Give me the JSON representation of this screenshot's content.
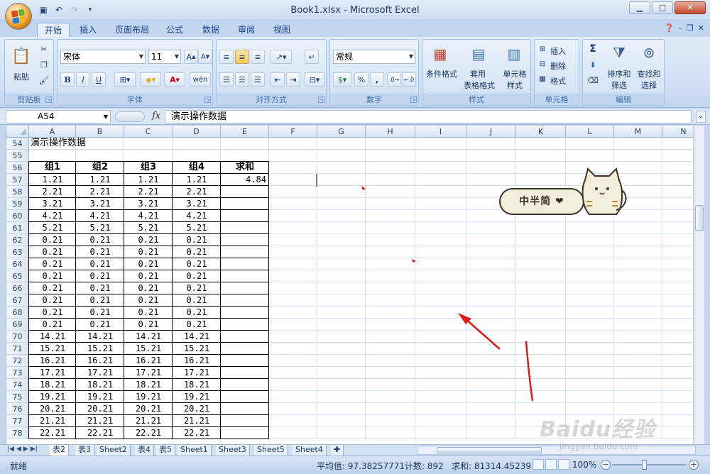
{
  "window": {
    "title": "Book1.xlsx - Microsoft Excel",
    "minimize": "▁",
    "maximize": "□",
    "close": "✕"
  },
  "ribbon_tabs": [
    "开始",
    "插入",
    "页面布局",
    "公式",
    "数据",
    "审阅",
    "视图"
  ],
  "active_tab": "开始",
  "clipboard": {
    "paste": "粘贴",
    "label": "剪贴板"
  },
  "font": {
    "name": "宋体",
    "size": "11",
    "label": "字体",
    "bold": "B",
    "italic": "I",
    "underline": "U",
    "phonetic": "wén"
  },
  "alignment": {
    "label": "对齐方式"
  },
  "number": {
    "format": "常规",
    "label": "数字",
    "percent": "%",
    "comma": ",",
    "inc": "←.0\n.00",
    "dec": ".00\n→.0"
  },
  "styles": {
    "conditional": "条件格式",
    "table1": "套用",
    "table2": "表格格式",
    "cell1": "单元格",
    "cell2": "样式",
    "label": "样式"
  },
  "cells": {
    "insert": "插入",
    "delete": "删除",
    "format": "格式",
    "label": "单元格"
  },
  "editing": {
    "sum": "Σ",
    "sort1": "排序和",
    "sort2": "筛选",
    "find1": "查找和",
    "find2": "选择",
    "label": "编辑"
  },
  "formula_bar": {
    "name_box": "A54",
    "fx": "fx",
    "content": "演示操作数据"
  },
  "grid": {
    "columns": [
      "A",
      "B",
      "C",
      "D",
      "E",
      "F",
      "G",
      "H",
      "I",
      "J",
      "K",
      "L",
      "M",
      "N"
    ],
    "rows": [
      54,
      55,
      56,
      57,
      58,
      59,
      60,
      61,
      62,
      63,
      64,
      65,
      66,
      67,
      68,
      69,
      70,
      71,
      72,
      73,
      74,
      75,
      76,
      77,
      78
    ],
    "title_cell": "演示操作数据",
    "headers": [
      "组1",
      "组2",
      "组3",
      "组4",
      "求和"
    ],
    "data": [
      [
        "1.21",
        "1.21",
        "1.21",
        "1.21",
        "4.84"
      ],
      [
        "2.21",
        "2.21",
        "2.21",
        "2.21",
        ""
      ],
      [
        "3.21",
        "3.21",
        "3.21",
        "3.21",
        ""
      ],
      [
        "4.21",
        "4.21",
        "4.21",
        "4.21",
        ""
      ],
      [
        "5.21",
        "5.21",
        "5.21",
        "5.21",
        ""
      ],
      [
        "0.21",
        "0.21",
        "0.21",
        "0.21",
        ""
      ],
      [
        "0.21",
        "0.21",
        "0.21",
        "0.21",
        ""
      ],
      [
        "0.21",
        "0.21",
        "0.21",
        "0.21",
        ""
      ],
      [
        "0.21",
        "0.21",
        "0.21",
        "0.21",
        ""
      ],
      [
        "0.21",
        "0.21",
        "0.21",
        "0.21",
        ""
      ],
      [
        "0.21",
        "0.21",
        "0.21",
        "0.21",
        ""
      ],
      [
        "0.21",
        "0.21",
        "0.21",
        "0.21",
        ""
      ],
      [
        "0.21",
        "0.21",
        "0.21",
        "0.21",
        ""
      ],
      [
        "14.21",
        "14.21",
        "14.21",
        "14.21",
        ""
      ],
      [
        "15.21",
        "15.21",
        "15.21",
        "15.21",
        ""
      ],
      [
        "16.21",
        "16.21",
        "16.21",
        "16.21",
        ""
      ],
      [
        "17.21",
        "17.21",
        "17.21",
        "17.21",
        ""
      ],
      [
        "18.21",
        "18.21",
        "18.21",
        "18.21",
        ""
      ],
      [
        "19.21",
        "19.21",
        "19.21",
        "19.21",
        ""
      ],
      [
        "20.21",
        "20.21",
        "20.21",
        "20.21",
        ""
      ],
      [
        "21.21",
        "21.21",
        "21.21",
        "21.21",
        ""
      ],
      [
        "22.21",
        "22.21",
        "22.21",
        "22.21",
        ""
      ]
    ]
  },
  "sticker_text": "中半简 ❤",
  "sheet_tabs": [
    "表2",
    "表3",
    "Sheet2",
    "表4",
    "表5",
    "Sheet1",
    "Sheet3",
    "Sheet5",
    "Sheet4"
  ],
  "active_sheet": "表2",
  "status": {
    "mode": "就绪",
    "average": "平均值: 97.38257771",
    "count": "计数: 892",
    "sum": "求和: 81314.45239",
    "zoom": "100%"
  },
  "watermark": {
    "brand": "Baidu经验",
    "url": "jingyan.baidu.com"
  },
  "colors": {
    "accent": "#15428b",
    "annotation": "#e11818"
  }
}
